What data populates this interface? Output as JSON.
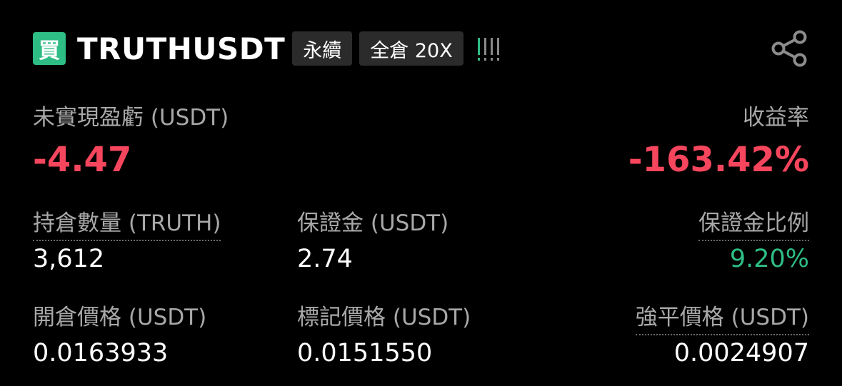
{
  "position": {
    "side_label": "買",
    "symbol": "TRUTHUSDT",
    "contract_type": "永續",
    "margin_mode": "全倉 20X"
  },
  "icons": {
    "share": "share-icon",
    "risk": "risk-level-icon"
  },
  "colors": {
    "buy_green": "#2ebd85",
    "loss_red": "#f6465d",
    "risk_bars": [
      "#2ebd85",
      "#8a8a8a",
      "#8a8a8a",
      "#8a8a8a"
    ]
  },
  "risk_level": {
    "active": 1,
    "total": 4
  },
  "pnl": {
    "label": "未實現盈虧 (USDT)",
    "value": "-4.47"
  },
  "roe": {
    "label": "收益率",
    "value": "-163.42%"
  },
  "stats": {
    "size_label": "持倉數量 (TRUTH)",
    "size_value": "3,612",
    "margin_label": "保證金 (USDT)",
    "margin_value": "2.74",
    "margin_ratio_label": "保證金比例",
    "margin_ratio_value": "9.20%",
    "entry_price_label": "開倉價格 (USDT)",
    "entry_price_value": "0.0163933",
    "mark_price_label": "標記價格 (USDT)",
    "mark_price_value": "0.0151550",
    "liq_price_label": "強平價格 (USDT)",
    "liq_price_value": "0.0024907"
  }
}
